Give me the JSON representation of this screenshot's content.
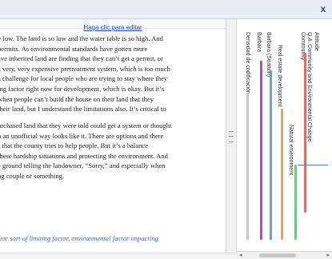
{
  "window": {
    "close_glyph": "x",
    "edit_link": "Haga clic para editar"
  },
  "document": {
    "paragraphs": [
      [
        "y low. The land is so low and the water table is so high. And",
        "permits. As environmental standards have gotten more",
        "ave inherited land are finding that they can’t get a permit, or",
        "a very, very expensive pretreatment system, which is too much",
        "a challenge for local people who are trying to stay where they",
        "ing factor right now for development, which is okay. But it’s",
        "when people can’t build the house on their land that they",
        "their land, but I understand the limitations also. It’s critical to"
      ],
      [
        "urchased land that they were told could get a system or thought",
        "n an unofficial way looks like it. There are options and there",
        "s that the county tries to help people. But it’s a balance",
        "these hardship situations and protecting the environment. And",
        "e ground telling the landowner, “Sorry,” and especially when",
        "ng couple or something."
      ]
    ],
    "caption": "ior sort of limiting factor, environmental factor impacting"
  },
  "coding_stripes": {
    "density_label": "Densidad de codificación",
    "codes": [
      {
        "label": "Attitude",
        "color": "#e06b6b"
      },
      {
        "label": "Q.4. Community and Environmental Change",
        "color": "#e06b6b"
      },
      {
        "label": "Community",
        "color": "#e06b6b"
      },
      {
        "label": "Real estate development",
        "color": "#e7a45a"
      },
      {
        "label": "Natural environment",
        "color": "#6ccb8a"
      },
      {
        "label": "Barbara (Stratton)",
        "color": "#5aa6d6"
      },
      {
        "label": "Barbara",
        "color": "#c33fd8"
      }
    ]
  }
}
